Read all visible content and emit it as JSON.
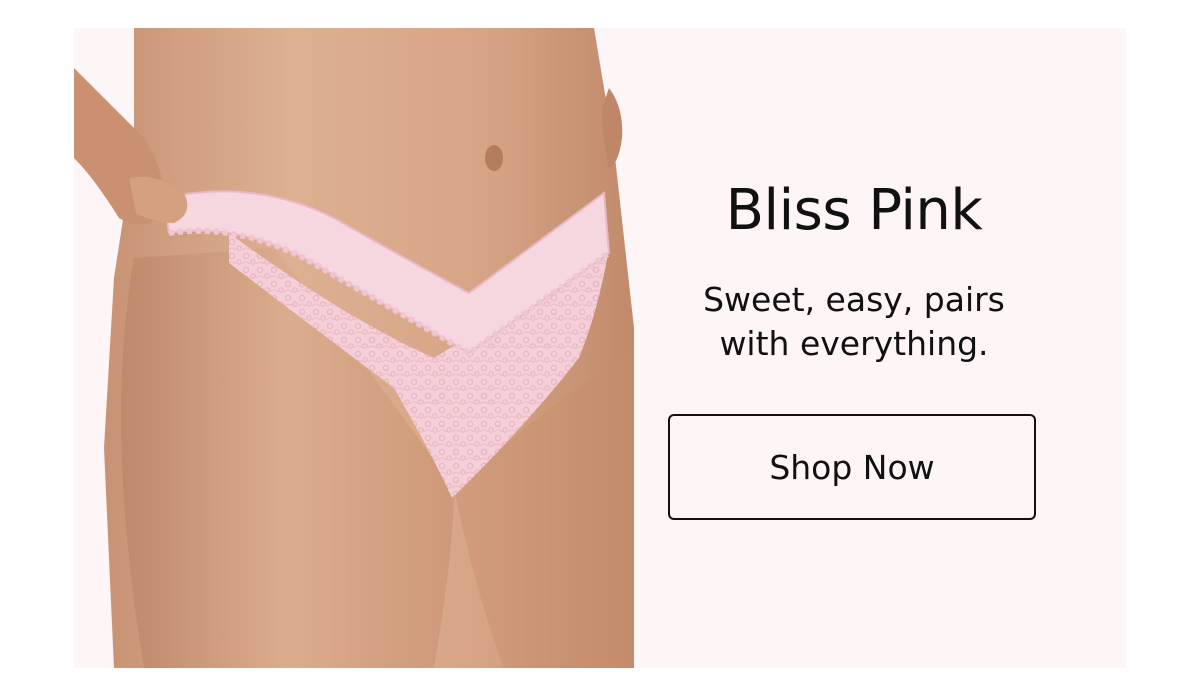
{
  "banner": {
    "background_color": "#fdf5f6",
    "image_alt_subject": "lace thong in pale pink"
  },
  "copy": {
    "headline": "Bliss Pink",
    "subhead": "Sweet, easy, pairs with everything.",
    "cta_label": "Shop Now"
  },
  "colors": {
    "text": "#111111",
    "product_pink": "#f3c9d3",
    "skin": "#d8a482"
  }
}
